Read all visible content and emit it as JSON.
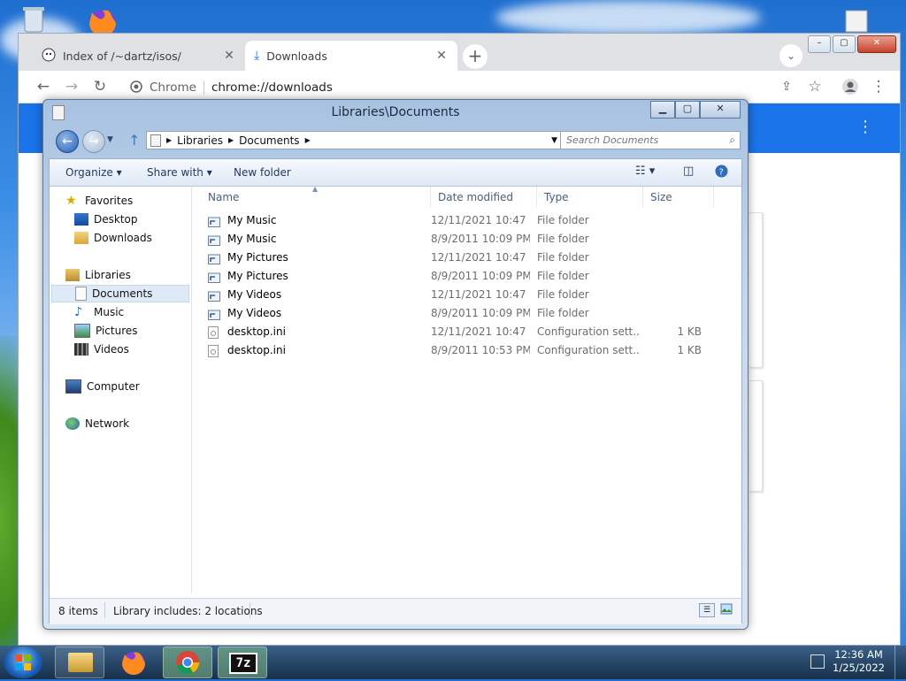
{
  "chrome": {
    "tabs": [
      {
        "title": "Index of /~dartz/isos/",
        "active": false
      },
      {
        "title": "Downloads",
        "active": true
      }
    ],
    "new_tab": "+",
    "toolbar": {
      "url_chip": "Chrome",
      "url": "chrome://downloads"
    },
    "window_controls": {
      "minimize": "–",
      "maximize": "▢",
      "close": "✕"
    }
  },
  "explorer": {
    "title": "Libraries\\Documents",
    "breadcrumb": [
      "Libraries",
      "Documents"
    ],
    "search_placeholder": "Search Documents",
    "commands": {
      "organize": "Organize ▾",
      "share": "Share with ▾",
      "new_folder": "New folder"
    },
    "nav": {
      "favorites": "Favorites",
      "desktop": "Desktop",
      "downloads": "Downloads",
      "libraries": "Libraries",
      "documents": "Documents",
      "music": "Music",
      "pictures": "Pictures",
      "videos": "Videos",
      "computer": "Computer",
      "network": "Network"
    },
    "columns": {
      "name": "Name",
      "date": "Date modified",
      "type": "Type",
      "size": "Size"
    },
    "files": [
      {
        "name": "My Music",
        "date": "12/11/2021 10:47 ...",
        "type": "File folder",
        "size": ""
      },
      {
        "name": "My Music",
        "date": "8/9/2011 10:09 PM",
        "type": "File folder",
        "size": ""
      },
      {
        "name": "My Pictures",
        "date": "12/11/2021 10:47 ...",
        "type": "File folder",
        "size": ""
      },
      {
        "name": "My Pictures",
        "date": "8/9/2011 10:09 PM",
        "type": "File folder",
        "size": ""
      },
      {
        "name": "My Videos",
        "date": "12/11/2021 10:47 ...",
        "type": "File folder",
        "size": ""
      },
      {
        "name": "My Videos",
        "date": "8/9/2011 10:09 PM",
        "type": "File folder",
        "size": ""
      },
      {
        "name": "desktop.ini",
        "date": "12/11/2021 10:47 ...",
        "type": "Configuration sett...",
        "size": "1 KB"
      },
      {
        "name": "desktop.ini",
        "date": "8/9/2011 10:53 PM",
        "type": "Configuration sett...",
        "size": "1 KB"
      }
    ],
    "status": {
      "count": "8 items",
      "library": "Library includes: 2 locations"
    },
    "window_controls": {
      "minimize": "▁",
      "maximize": "▢",
      "close": "✕"
    }
  },
  "taskbar": {
    "time": "12:36 AM",
    "date": "1/25/2022",
    "seven_zip_label": "7z"
  },
  "colors": {
    "chrome_blue": "#1a73e8",
    "selection": "#dfeaf7"
  }
}
